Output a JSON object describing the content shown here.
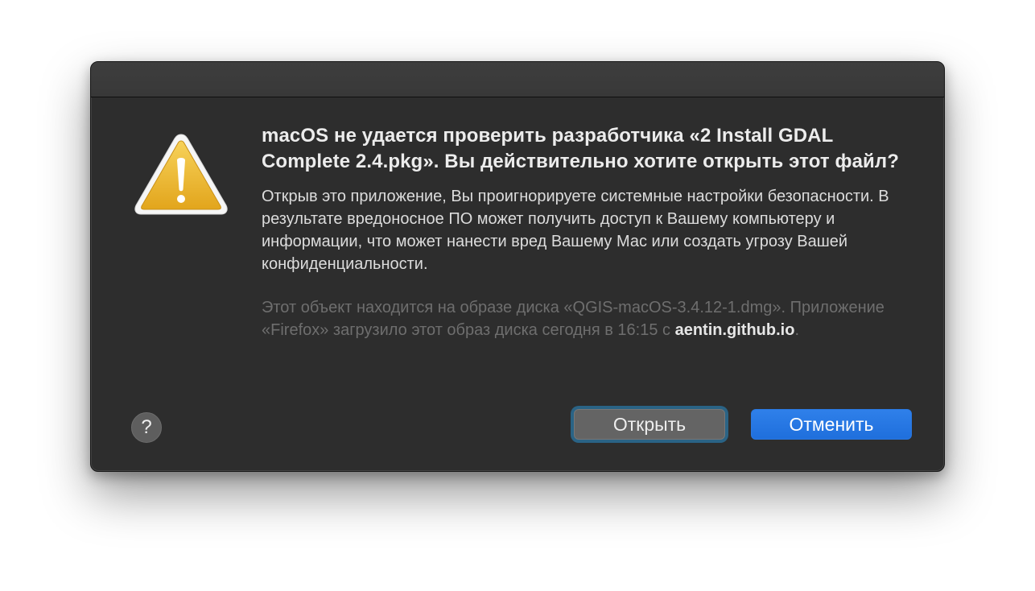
{
  "dialog": {
    "title": "macOS не удается проверить разработчика «2 Install GDAL Complete 2.4.pkg». Вы действительно хотите открыть этот файл?",
    "body": "Открыв это приложение, Вы проигнорируете системные настройки безопасности. В результате вредоносное ПО может получить доступ к Вашему компьютеру и информации, что может нанести вред Вашему Мас или создать угрозу Вашей конфиденциальности.",
    "source_text": "Этот объект находится на образе диска «QGIS-macOS-3.4.12-1.dmg». Приложение «Firefox» загрузило этот образ диска сегодня в 16:15 с ",
    "source_domain": "aentin.github.io",
    "source_period": ".",
    "icon": "warning-icon"
  },
  "buttons": {
    "help_label": "?",
    "open_label": "Открыть",
    "cancel_label": "Отменить"
  },
  "colors": {
    "dialog_background": "#2d2d2d",
    "warning_yellow": "#f0b92b",
    "primary_blue": "#2a78e0",
    "focus_ring": "#2a6385"
  }
}
